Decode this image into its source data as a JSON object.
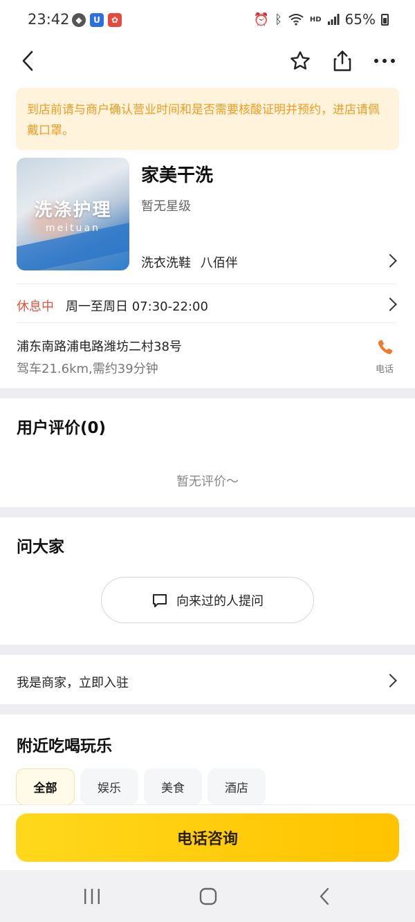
{
  "status_bar": {
    "time": "23:42",
    "battery": "65%",
    "network": "HD"
  },
  "notice": {
    "text": "到店前请与商户确认营业时间和是否需要核酸证明并预约，进店请佩戴口罩。"
  },
  "shop": {
    "image_title": "洗涤护理",
    "image_subtitle": "meituan",
    "name": "家美干洗",
    "rating": "暂无星级",
    "category": "洗衣洗鞋",
    "district": "八佰伴"
  },
  "hours": {
    "status": "休息中",
    "text": "周一至周日 07:30-22:00"
  },
  "location": {
    "address": "浦东南路浦电路潍坊二村38号",
    "distance": "驾车21.6km,需约39分钟",
    "phone_label": "电话"
  },
  "reviews": {
    "title": "用户评价(0)",
    "empty_text": "暂无评价～"
  },
  "ask": {
    "title": "问大家",
    "button_label": "向来过的人提问"
  },
  "merchant": {
    "text": "我是商家，立即入驻"
  },
  "nearby": {
    "title": "附近吃喝玩乐",
    "tabs": [
      "全部",
      "娱乐",
      "美食",
      "酒店"
    ],
    "active_tab": "全部"
  },
  "bottom": {
    "call_label": "电话咨询"
  },
  "colors": {
    "accent_yellow": "#ffc300",
    "notice_text": "#f39b1f",
    "closed_red": "#e0553f",
    "phone_orange": "#f07a2b"
  }
}
